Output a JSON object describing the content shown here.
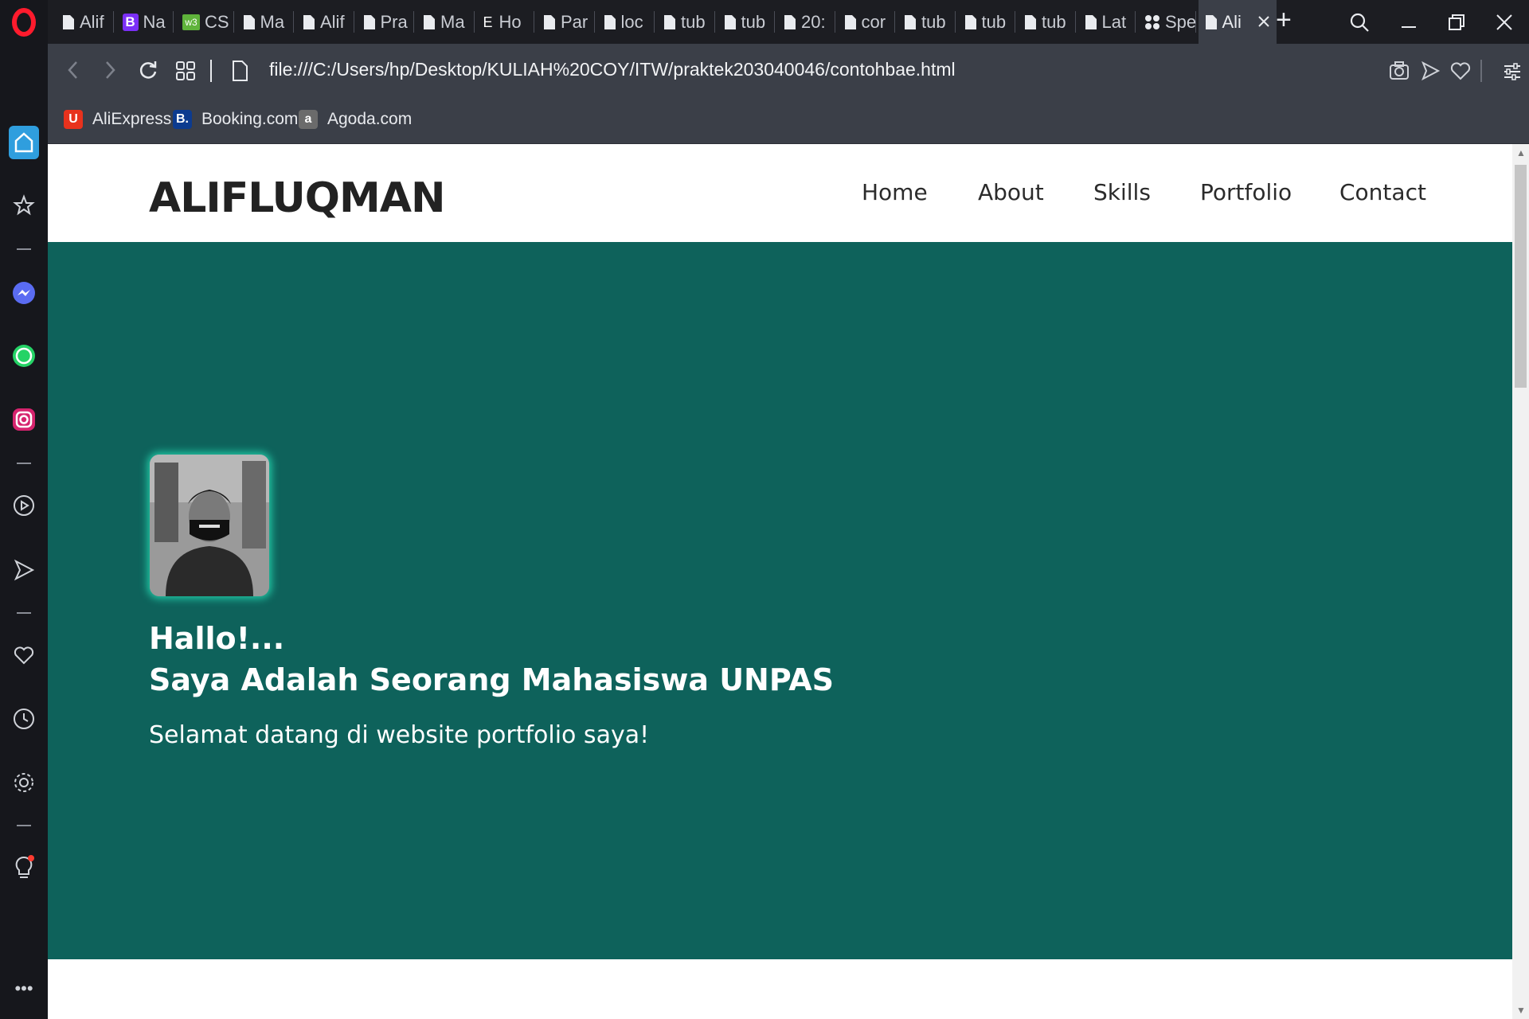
{
  "browser": {
    "tabs": [
      {
        "title": "Alif",
        "icon": "page-icon"
      },
      {
        "title": "Na",
        "icon": "bootstrap-icon"
      },
      {
        "title": "CS",
        "icon": "w3-icon"
      },
      {
        "title": "Ma",
        "icon": "page-icon"
      },
      {
        "title": "Alif",
        "icon": "page-icon"
      },
      {
        "title": "Pra",
        "icon": "page-icon"
      },
      {
        "title": "Ma",
        "icon": "page-icon"
      },
      {
        "title": "Ho",
        "icon": "envato-icon"
      },
      {
        "title": "Par",
        "icon": "page-icon"
      },
      {
        "title": "loc",
        "icon": "page-icon"
      },
      {
        "title": "tub",
        "icon": "page-icon"
      },
      {
        "title": "tub",
        "icon": "page-icon"
      },
      {
        "title": "20:",
        "icon": "page-icon"
      },
      {
        "title": "cor",
        "icon": "page-icon"
      },
      {
        "title": "tub",
        "icon": "page-icon"
      },
      {
        "title": "tub",
        "icon": "page-icon"
      },
      {
        "title": "tub",
        "icon": "page-icon"
      },
      {
        "title": "Lat",
        "icon": "page-icon"
      },
      {
        "title": "Spe",
        "icon": "speed-dial-icon"
      },
      {
        "title": "Ali",
        "icon": "page-icon",
        "active": true
      }
    ],
    "new_tab_symbol": "+",
    "url": "file:///C:/Users/hp/Desktop/KULIAH%20COY/ITW/praktek203040046/contohbae.html",
    "bookmarks": [
      {
        "label": "AliExpress",
        "icon_text": "U",
        "color": "#e8321d"
      },
      {
        "label": "Booking.com",
        "icon_text": "B.",
        "color": "#0c3b8f"
      },
      {
        "label": "Agoda.com",
        "icon_text": "a",
        "color": "#6b6b6b"
      }
    ],
    "accent_color": "#2f9ede"
  },
  "site": {
    "brand": "ALIFLUQMAN",
    "nav": [
      "Home",
      "About",
      "Skills",
      "Portfolio",
      "Contact"
    ],
    "hero": {
      "greeting": "Hallo!...",
      "headline": "Saya Adalah Seorang Mahasiswa UNPAS",
      "subtitle": "Selamat datang di website portfolio saya!",
      "background_color": "#0e625b",
      "avatar_glow_color": "#22c9a6"
    }
  }
}
